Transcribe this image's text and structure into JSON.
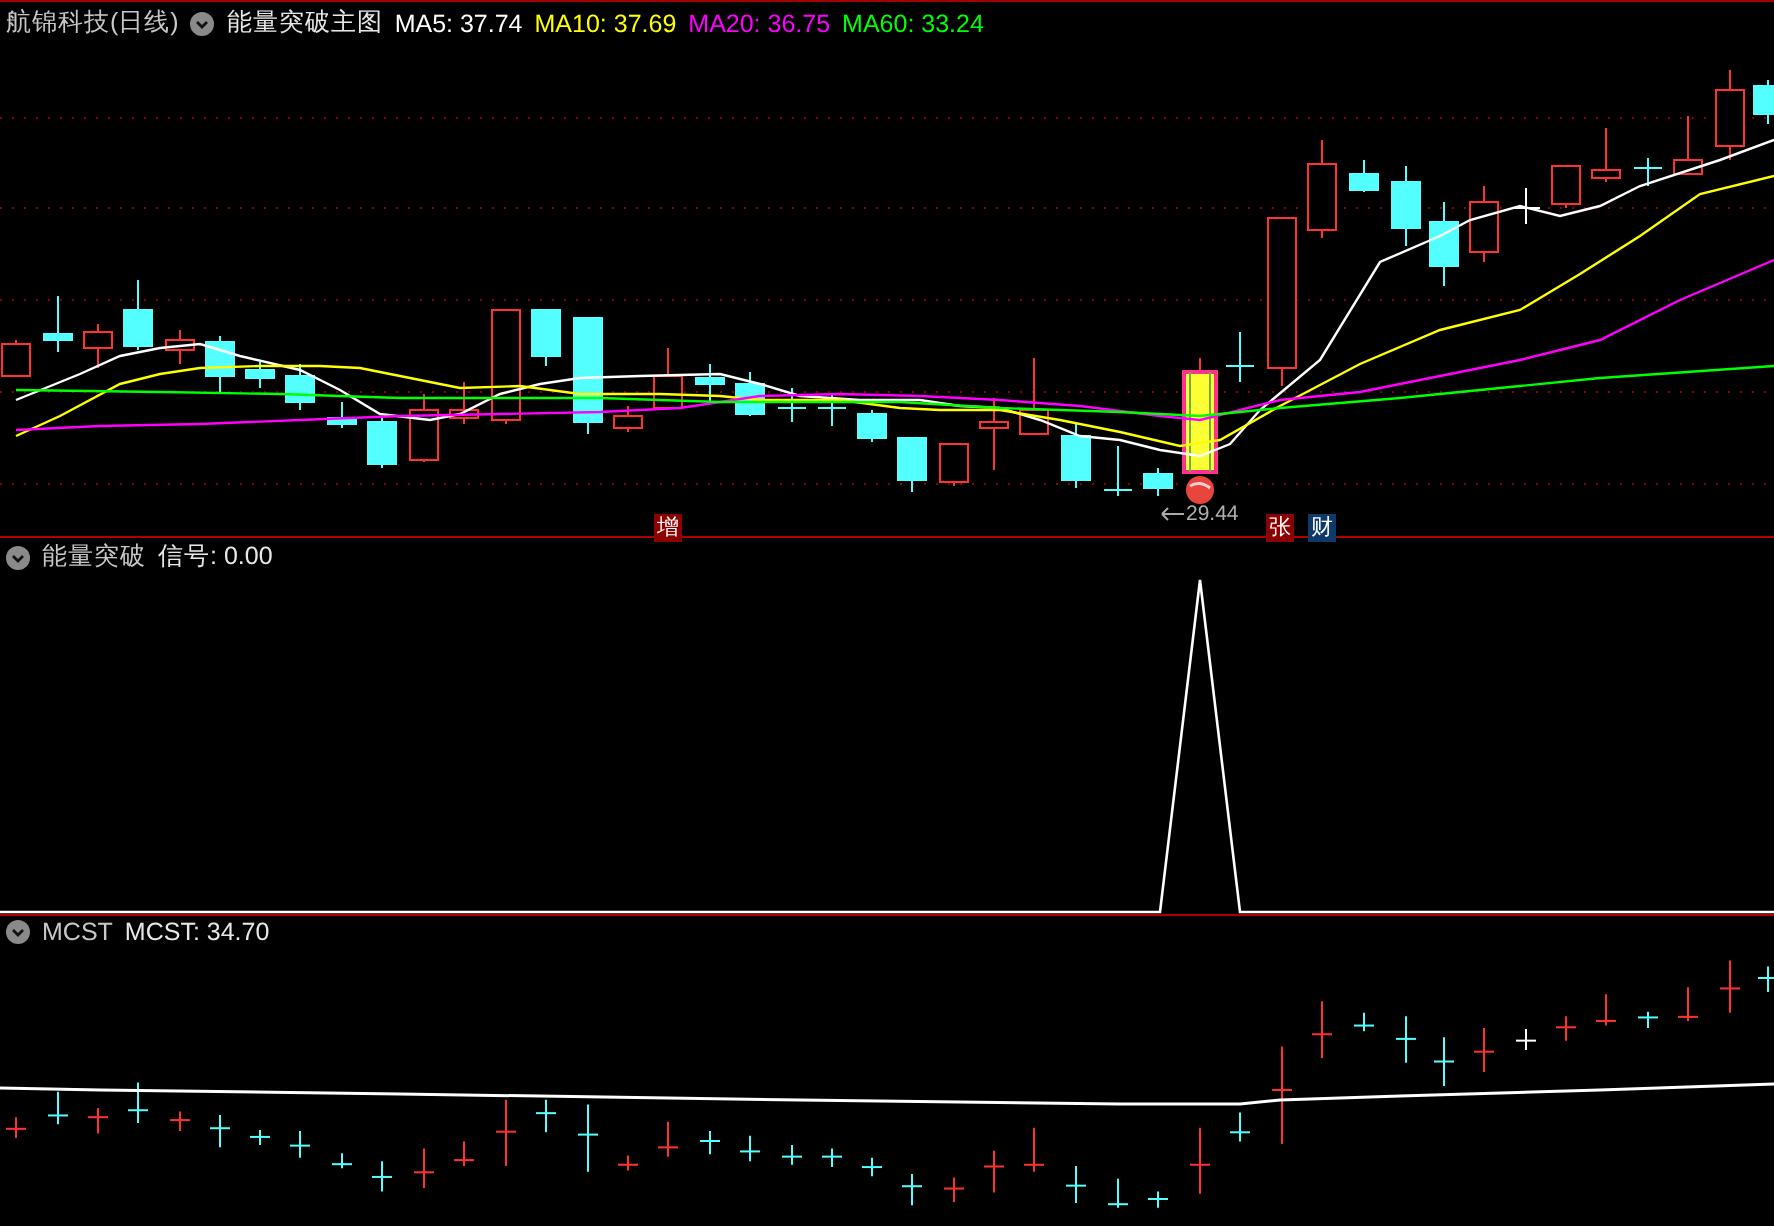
{
  "main_panel": {
    "stock_title": "航锦科技(日线)",
    "indicator_name": "能量突破主图",
    "moving_averages": [
      {
        "label": "MA5: 37.74",
        "color": "#ffffff"
      },
      {
        "label": "MA10: 37.69",
        "color": "#ffff00"
      },
      {
        "label": "MA20: 36.75",
        "color": "#ff00ff"
      },
      {
        "label": "MA60: 33.24",
        "color": "#00ff00"
      }
    ],
    "price_label": "29.44",
    "signal_markers": [
      {
        "text": "增",
        "color": "#8b0000"
      },
      {
        "text": "张",
        "color": "#8b0000"
      },
      {
        "text": "财",
        "color": "#0d3a6a"
      }
    ]
  },
  "signal_panel": {
    "indicator_name": "能量突破",
    "reading": "信号: 0.00"
  },
  "mcst_panel": {
    "indicator_name": "MCST",
    "reading": "MCST: 34.70"
  }
}
